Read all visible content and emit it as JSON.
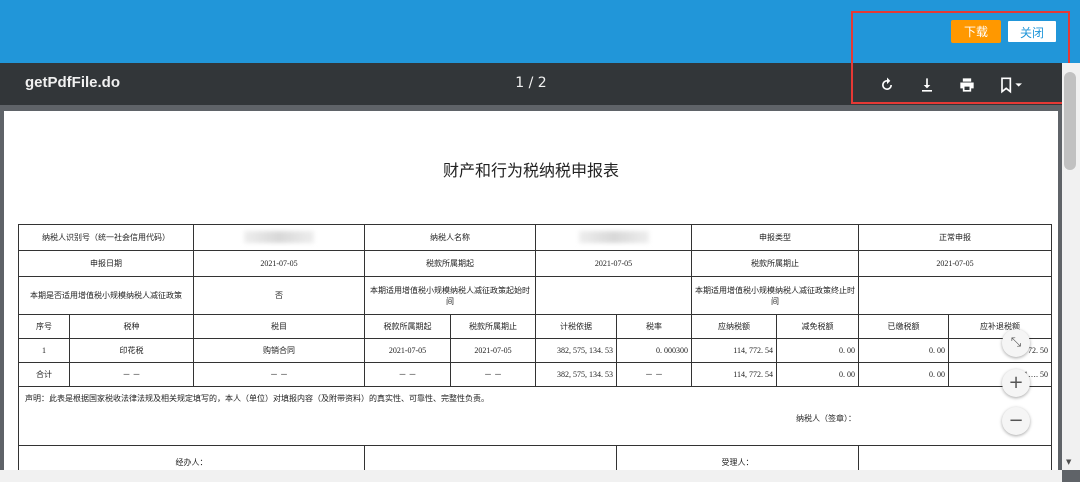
{
  "topbar": {
    "download_label": "下载",
    "close_label": "关闭"
  },
  "viewer": {
    "file_title": "getPdfFile.do",
    "page_indicator": "1 / 2"
  },
  "document": {
    "title": "财产和行为税纳税申报表",
    "info": {
      "taxpayer_id_label": "纳税人识别号（统一社会信用代码）",
      "taxpayer_name_label": "纳税人名称",
      "report_type_label": "申报类型",
      "report_type_value": "正常申报",
      "report_date_label": "申报日期",
      "report_date_value": "2021-07-05",
      "period_start_label": "税款所属期起",
      "period_start_value": "2021-07-05",
      "period_end_label": "税款所属期止",
      "period_end_value": "2021-07-05",
      "small_scale_label": "本期是否适用增值税小规模纳税人减征政策",
      "small_scale_value": "否",
      "policy_start_label": "本期适用增值税小规模纳税人减征政策起始时间",
      "policy_end_label": "本期适用增值税小规模纳税人减征政策终止时间"
    },
    "columns": [
      "序号",
      "税种",
      "税目",
      "税款所属期起",
      "税款所属期止",
      "计税依据",
      "税率",
      "应纳税额",
      "减免税额",
      "已缴税额",
      "应补退税额"
    ],
    "rows": [
      [
        "1",
        "印花税",
        "购销合同",
        "2021-07-05",
        "2021-07-05",
        "382, 575, 134. 53",
        "0. 000300",
        "114, 772. 54",
        "0. 00",
        "0. 00",
        "114, 772. 50"
      ],
      [
        "合计",
        "－ －",
        "－ －",
        "－ －",
        "－ －",
        "382, 575, 134. 53",
        "－ －",
        "114, 772. 54",
        "0. 00",
        "0. 00",
        "11…. 50"
      ]
    ],
    "declaration": "声明：此表是根据国家税收法律法规及相关规定填写的，本人（单位）对填报内容（及附带资料）的真实性、可靠性、完整性负责。",
    "signature_label": "纳税人（签章）：",
    "handler_label": "经办人：",
    "receiver_label": "受理人："
  },
  "icons": [
    "rotate-icon",
    "download-icon",
    "print-icon",
    "bookmark-icon",
    "fit-page-icon",
    "zoom-in-icon",
    "zoom-out-icon"
  ],
  "colors": {
    "topbar": "#2196d9",
    "download_button": "#ff9800",
    "viewer_bar": "#323639",
    "highlight": "#e53935"
  }
}
